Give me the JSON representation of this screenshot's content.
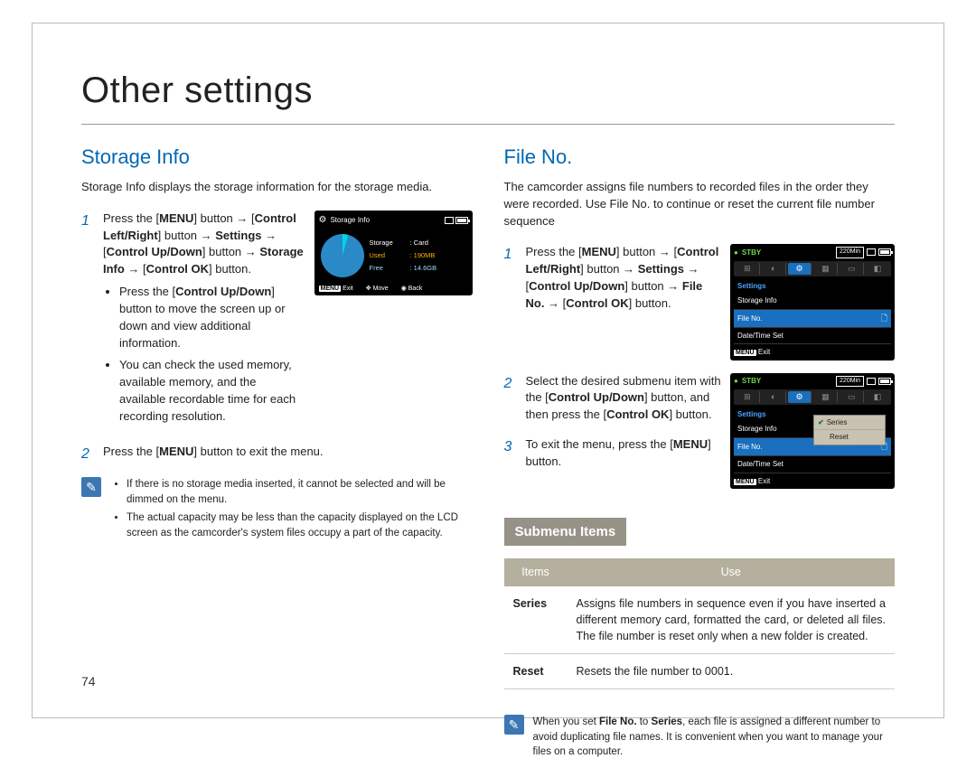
{
  "title": "Other settings",
  "page_num": "74",
  "left": {
    "heading": "Storage Info",
    "intro": "Storage Info displays the storage information for the storage media.",
    "step1": {
      "num": "1",
      "text_parts": [
        "Press the [",
        "MENU",
        "] button → [",
        "Control Left/Right",
        "] button → ",
        "Settings",
        " → [",
        "Control Up/Down",
        "] button → ",
        "Storage Info",
        " → [",
        "Control OK",
        "] button."
      ],
      "b1": "Press the [Control Up/Down] button to move the screen up or down and view additional information.",
      "b2": "You can check the used memory, available memory, and the available recordable time for each recording resolution."
    },
    "step2": {
      "num": "2",
      "text": "Press the [MENU] button to exit the menu."
    },
    "note": {
      "b1": "If there is no storage media inserted, it cannot be selected and will be dimmed on the menu.",
      "b2": "The actual capacity may be less than the capacity displayed on the LCD screen as the camcorder's system files occupy a part of the capacity."
    },
    "lcd": {
      "title": "Storage Info",
      "storage_lbl": "Storage",
      "storage_val": ": Card",
      "used_lbl": "Used",
      "used_val": ": 190MB",
      "free_lbl": "Free",
      "free_val": ": 14.6GB",
      "exit": "Exit",
      "move": "Move",
      "back": "Back",
      "menu_btn": "MENU"
    }
  },
  "right": {
    "heading": "File No.",
    "intro": "The camcorder assigns file numbers to recorded files in the order they were recorded. Use File No. to continue or reset the current file number sequence",
    "step1": {
      "num": "1",
      "text_parts": [
        "Press the [",
        "MENU",
        "] button → [",
        "Control Left/Right",
        "] button → ",
        "Settings",
        " → [",
        "Control Up/Down",
        "] button → ",
        "File No.",
        " → [",
        "Control OK",
        "] button."
      ]
    },
    "step2": {
      "num": "2",
      "text": "Select the desired submenu item with the [Control Up/Down] button, and then press the [Control OK] button."
    },
    "step3": {
      "num": "3",
      "text": "To exit the menu, press the [MENU] button."
    },
    "submenu_heading": "Submenu Items",
    "table": {
      "h1": "Items",
      "h2": "Use",
      "r1c1": "Series",
      "r1c2": "Assigns file numbers in sequence even if you have inserted a different memory card, formatted the card, or deleted all files. The file number is reset only when a new folder is created.",
      "r2c1": "Reset",
      "r2c2": "Resets the file number to 0001."
    },
    "note": "When you set File No. to Series, each file is assigned a different number to avoid duplicating file names. It is convenient when you want to manage your files on a computer.",
    "lcd1": {
      "stby": "STBY",
      "time": "220Min",
      "settings": "Settings",
      "row1": "Storage Info",
      "row2": "File No.",
      "row3": "Date/Time Set",
      "menu_btn": "MENU",
      "exit": "Exit"
    },
    "lcd2": {
      "stby": "STBY",
      "time": "220Min",
      "settings": "Settings",
      "row1": "Storage Info",
      "row2": "File No.",
      "row3": "Date/Time Set",
      "pop1": "Series",
      "pop2": "Reset",
      "menu_btn": "MENU",
      "exit": "Exit"
    }
  }
}
